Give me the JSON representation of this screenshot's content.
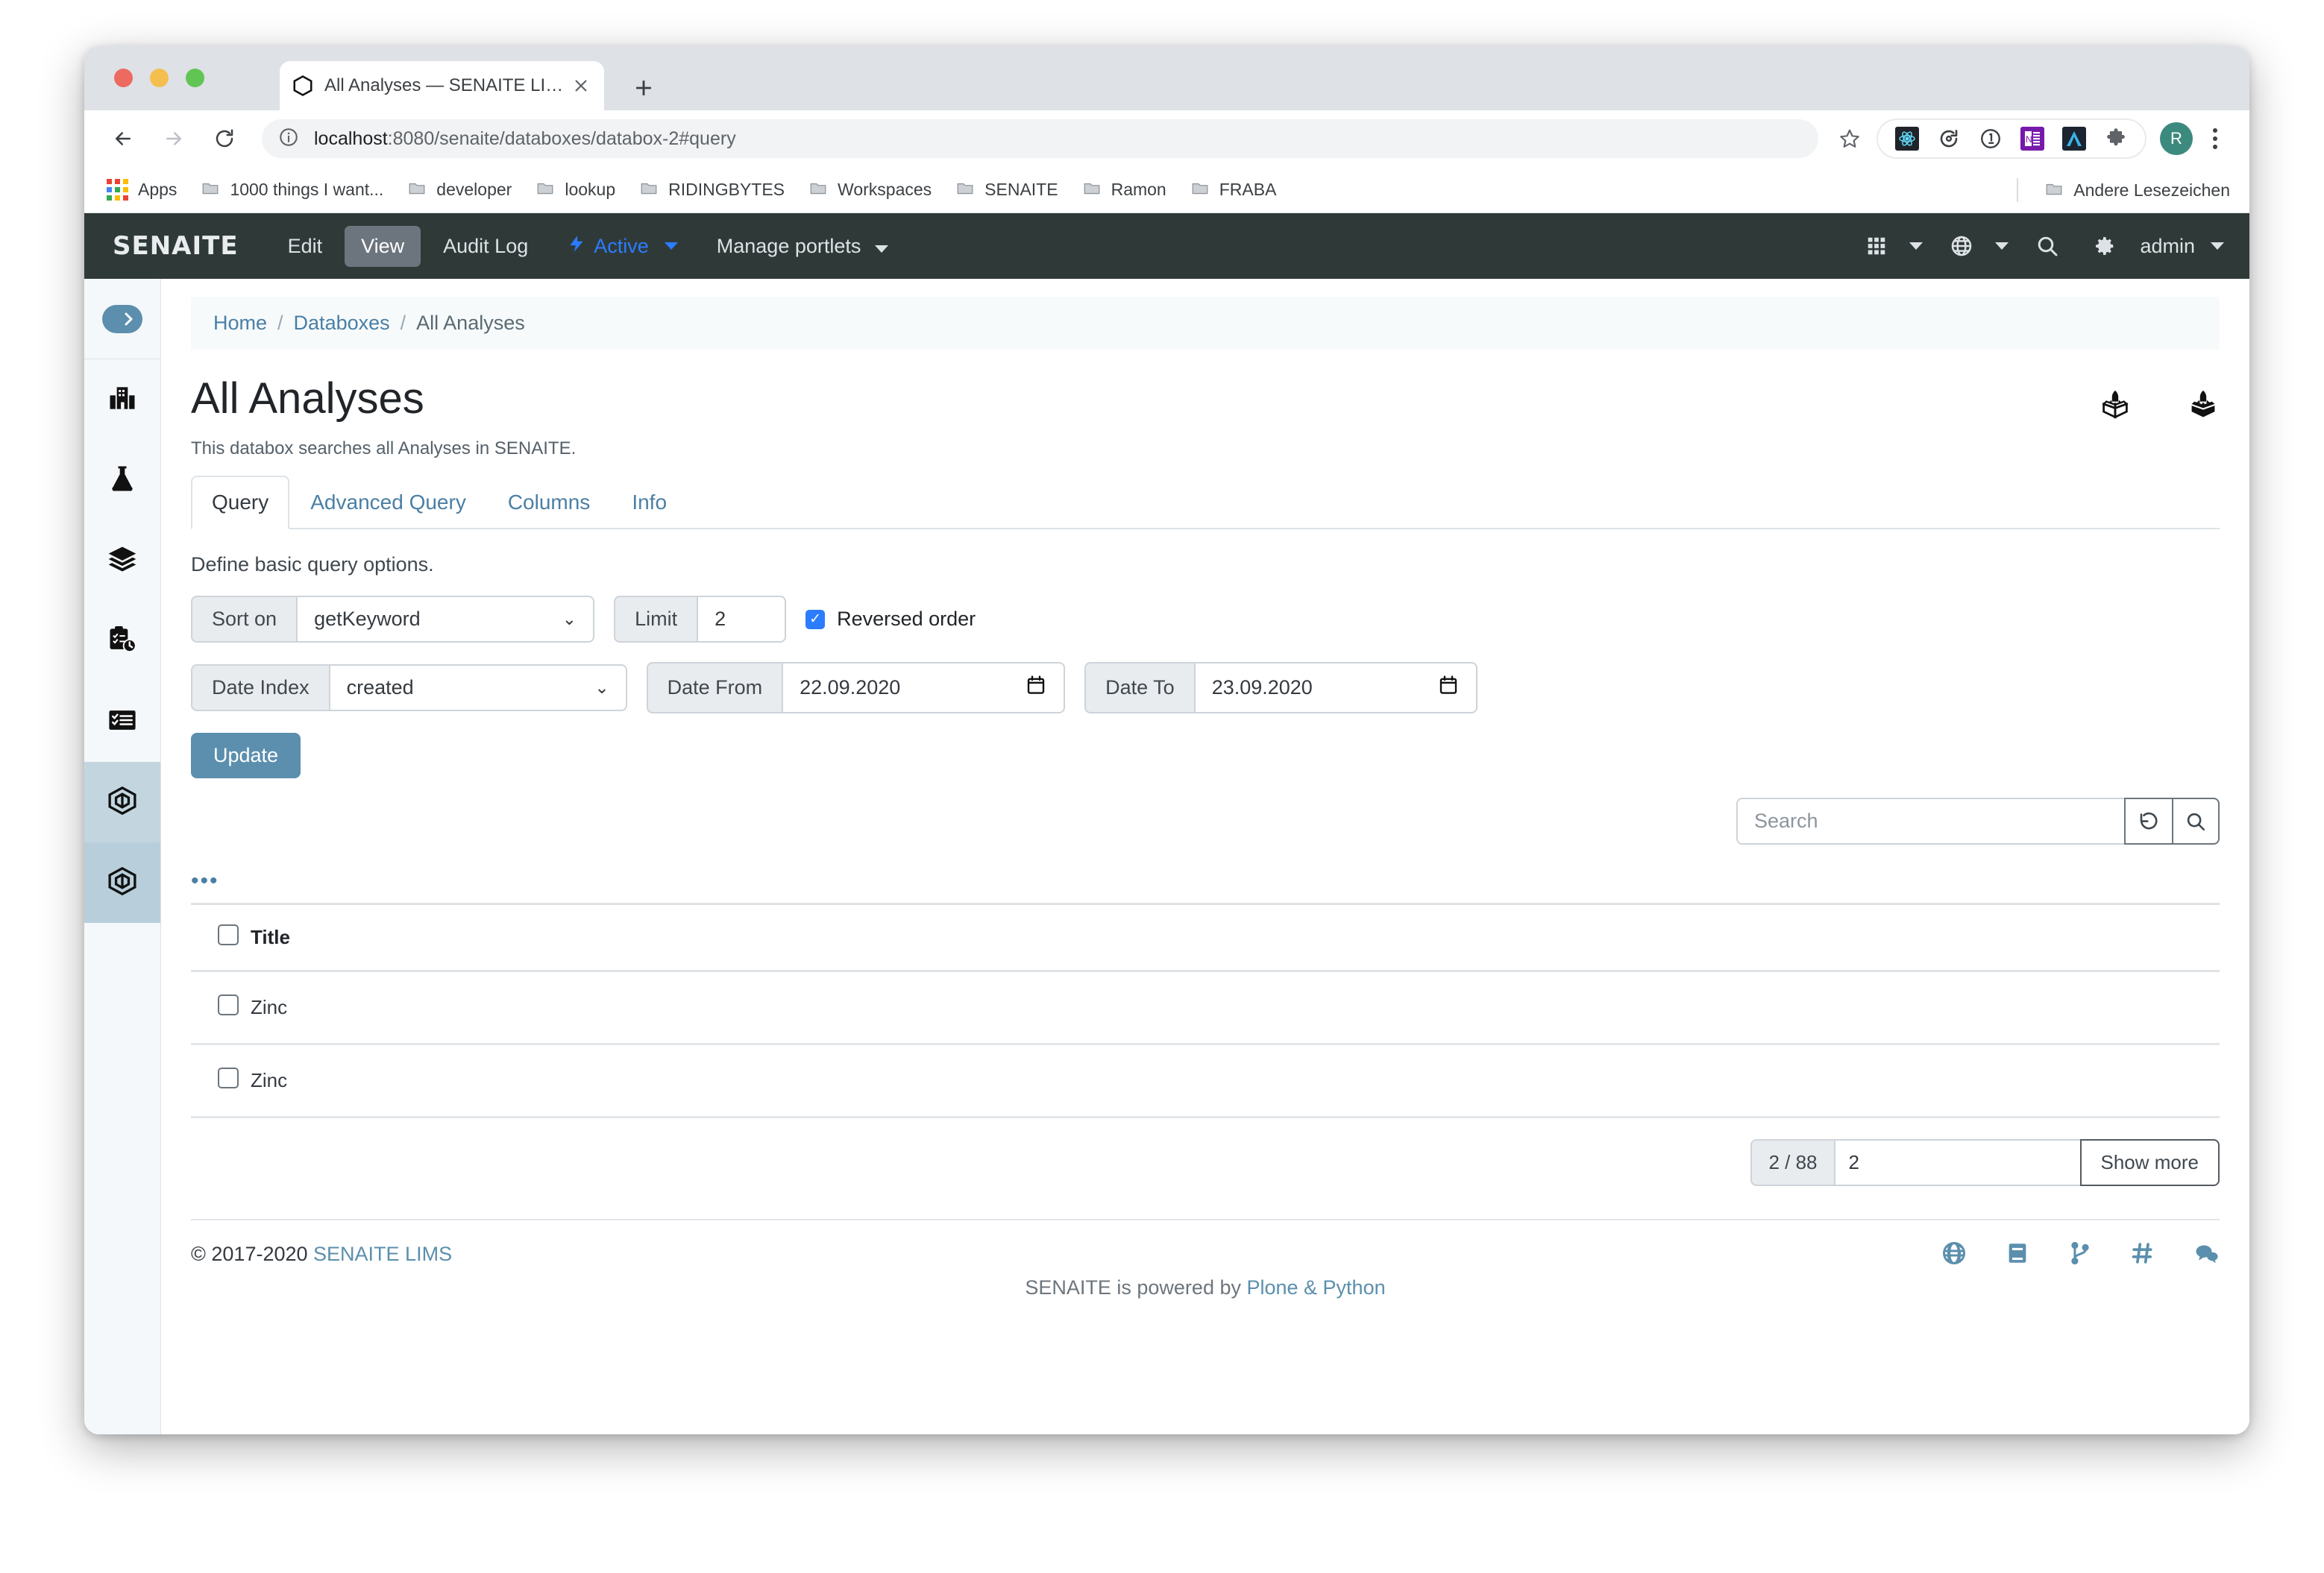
{
  "browser": {
    "tab": {
      "title": "All Analyses — SENAITE LIMS",
      "favicon_icon": "hexagon-icon",
      "close_icon": "close-icon"
    },
    "new_tab_label": "+",
    "nav": {
      "back_icon": "arrow-left-icon",
      "forward_icon": "arrow-right-icon",
      "reload_icon": "reload-icon"
    },
    "omnibox": {
      "info_icon": "info-circle-icon",
      "url_host": "localhost",
      "url_path": ":8080/senaite/databoxes/databox-2#query",
      "star_icon": "star-icon"
    },
    "extensions": [
      {
        "name": "react-devtools-icon",
        "color": "#20232a"
      },
      {
        "name": "tab-reload-icon",
        "color": "#3c4043"
      },
      {
        "name": "onepassword-icon",
        "color": "#3c4043"
      },
      {
        "name": "onenote-icon",
        "color": "#7719aa"
      },
      {
        "name": "angular-icon",
        "color": "#1b2430"
      },
      {
        "name": "puzzle-extensions-icon",
        "color": "#5f6368"
      }
    ],
    "profile_initial": "R",
    "menu_icon": "kebab-menu-icon",
    "bookmarks": {
      "apps_label": "Apps",
      "items": [
        "1000 things I want...",
        "developer",
        "lookup",
        "RIDINGBYTES",
        "Workspaces",
        "SENAITE",
        "Ramon",
        "FRABA"
      ],
      "other_label": "Andere Lesezeichen"
    }
  },
  "topnav": {
    "brand": "SENAITE",
    "items": [
      {
        "label": "Edit",
        "active": false,
        "caret": false
      },
      {
        "label": "View",
        "active": true,
        "caret": false
      },
      {
        "label": "Audit Log",
        "active": false,
        "caret": false
      },
      {
        "label": "Active",
        "active": false,
        "caret": true,
        "accent": true,
        "icon": "bolt-icon"
      },
      {
        "label": "Manage portlets",
        "active": false,
        "caret": true
      }
    ],
    "right": {
      "grid_icon": "apps-grid-icon",
      "globe_icon": "globe-icon",
      "search_icon": "search-icon",
      "gear_icon": "gear-icon",
      "user_label": "admin"
    }
  },
  "sidebar": {
    "toggle_icon": "chevron-right-toggle-icon",
    "items": [
      {
        "icon": "clients-building-icon",
        "selected": false
      },
      {
        "icon": "samples-flask-icon",
        "selected": false
      },
      {
        "icon": "batches-layers-icon",
        "selected": false
      },
      {
        "icon": "worksheets-clipboard-clock-icon",
        "selected": false
      },
      {
        "icon": "tasks-list-icon",
        "selected": false
      },
      {
        "icon": "databox-cube-icon",
        "selected": true
      },
      {
        "icon": "databox-cube-icon",
        "selected": true
      }
    ]
  },
  "breadcrumb": {
    "items": [
      {
        "label": "Home",
        "link": true
      },
      {
        "label": "Databoxes",
        "link": true
      },
      {
        "label": "All Analyses",
        "link": false
      }
    ],
    "separator": "/"
  },
  "page": {
    "title": "All Analyses",
    "description": "This databox searches all Analyses in SENAITE.",
    "header_icons": [
      {
        "name": "databox-rocket-icon"
      },
      {
        "name": "databox-rocket-bold-icon"
      }
    ]
  },
  "tabs": [
    {
      "label": "Query",
      "active": true
    },
    {
      "label": "Advanced Query",
      "active": false
    },
    {
      "label": "Columns",
      "active": false
    },
    {
      "label": "Info",
      "active": false
    }
  ],
  "query": {
    "note": "Define basic query options.",
    "sort_on": {
      "label": "Sort on",
      "value": "getKeyword"
    },
    "limit": {
      "label": "Limit",
      "value": "2"
    },
    "reversed_order": {
      "label": "Reversed order",
      "checked": true,
      "check_glyph": "✓"
    },
    "date_index": {
      "label": "Date Index",
      "value": "created"
    },
    "date_from": {
      "label": "Date From",
      "value": "22.09.2020",
      "icon": "calendar-icon"
    },
    "date_to": {
      "label": "Date To",
      "value": "23.09.2020",
      "icon": "calendar-icon"
    },
    "update_button": "Update"
  },
  "search": {
    "placeholder": "Search",
    "value": "",
    "reset_icon": "reset-arrow-icon",
    "search_icon": "search-icon"
  },
  "listing": {
    "toggle_columns_label": "•••",
    "columns": [
      "",
      "Title"
    ],
    "rows": [
      {
        "checked": false,
        "title": "Zinc"
      },
      {
        "checked": false,
        "title": "Zinc"
      }
    ]
  },
  "pagination": {
    "count_label": "2 / 88",
    "input_value": "2",
    "show_more_label": "Show more"
  },
  "footer": {
    "copyright": "© 2017-2020",
    "brand_link": "SENAITE LIMS",
    "powered_prefix": "SENAITE is powered by ",
    "powered_link": "Plone & Python",
    "icons": [
      {
        "name": "globe-icon"
      },
      {
        "name": "book-docs-icon"
      },
      {
        "name": "git-branch-icon"
      },
      {
        "name": "hash-channel-icon"
      },
      {
        "name": "chat-bubbles-icon"
      }
    ]
  },
  "colors": {
    "topnav_bg": "#2f3a38",
    "accent_blue": "#2b7cff",
    "link_blue": "#4a7fa5",
    "button_blue": "#5b8fad",
    "sidebar_selected": "#b8cedb"
  }
}
